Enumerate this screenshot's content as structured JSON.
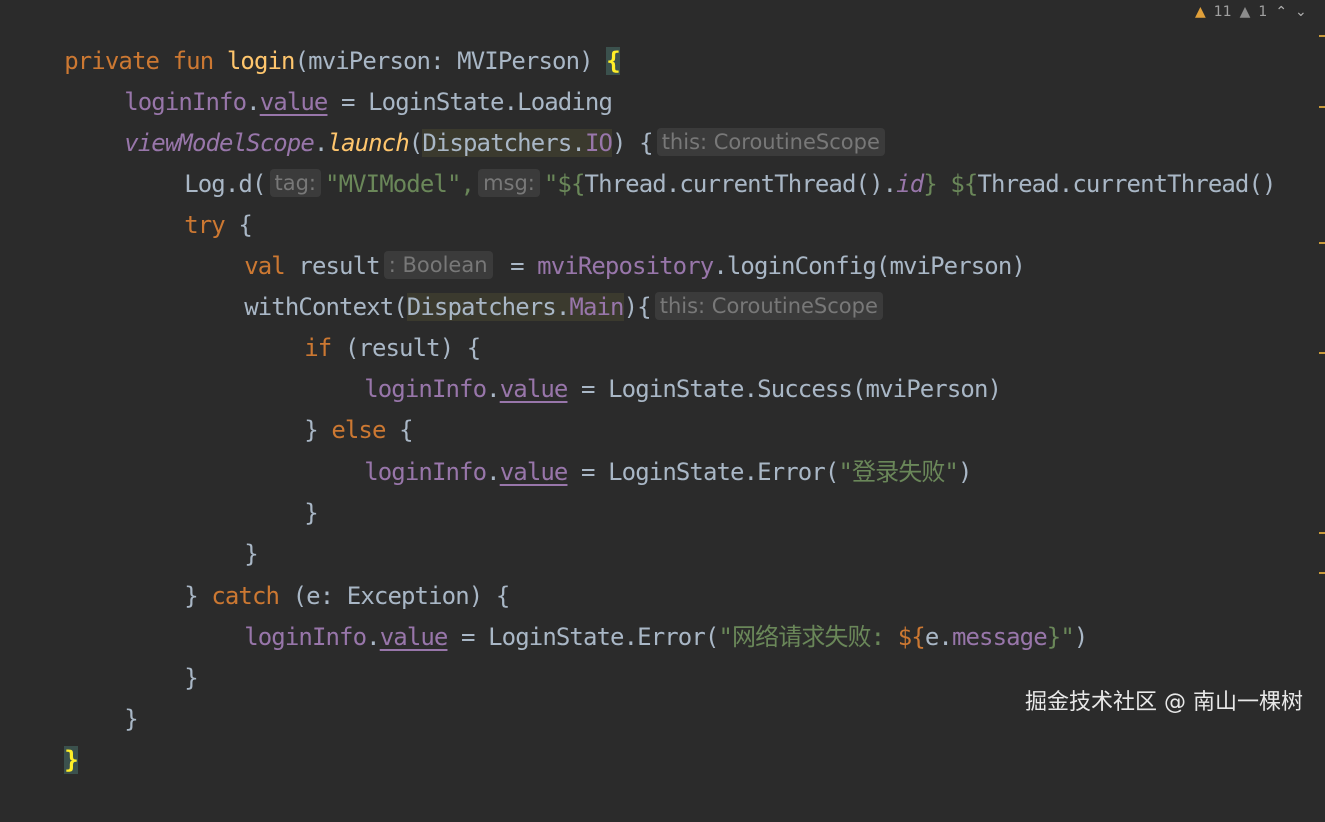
{
  "inspection": {
    "warnings": "11",
    "weak_warnings": "1"
  },
  "watermark": "掘金技术社区 @ 南山一棵树",
  "code": {
    "l1": {
      "kw1": "private",
      "kw2": "fun",
      "name": "login",
      "params": "(mviPerson: MVIPerson) ",
      "brace": "{"
    },
    "l2": {
      "a": "loginInfo",
      "dot": ".",
      "b": "value",
      "rest": " = LoginState.Loading"
    },
    "l3": {
      "a": "viewModelScope",
      "dot": ".",
      "b": "launch",
      "p1": "(",
      "c": "Dispatchers",
      "dot2": ".",
      "d": "IO",
      "p2": ") {",
      "hint": "this: CoroutineScope"
    },
    "l4": {
      "a": "Log.d(",
      "hint1": "tag:",
      "s1": "\"MVIModel\",",
      "hint2": "msg:",
      "s2": "\"${",
      "b": "Thread.currentThread().",
      "c": "id",
      "s3": "} ${",
      "d": "Thread.currentThread()"
    },
    "l5": {
      "kw": "try",
      "rest": " {"
    },
    "l6": {
      "kw": "val",
      "a": " result",
      "hint": ": Boolean",
      "b": " = ",
      "c": "mviRepository",
      "d": ".loginConfig(mviPerson)"
    },
    "l7": {
      "a": "withContext(",
      "c": "Dispatchers",
      "dot": ".",
      "d": "Main",
      "b": "){",
      "hint": "this: CoroutineScope"
    },
    "l8": {
      "kw": "if",
      "rest": " (result) {"
    },
    "l9": {
      "a": "loginInfo",
      "dot": ".",
      "b": "value",
      "rest": " = LoginState.Success(mviPerson)"
    },
    "l10": {
      "a": "} ",
      "kw": "else",
      "rest": " {"
    },
    "l11": {
      "a": "loginInfo",
      "dot": ".",
      "b": "value",
      "rest": " = LoginState.Error(",
      "s": "\"登录失败\"",
      "end": ")"
    },
    "l12": {
      "a": "}"
    },
    "l13": {
      "a": "}"
    },
    "l14": {
      "a": "} ",
      "kw": "catch",
      "rest": " (e: Exception) {"
    },
    "l15": {
      "a": "loginInfo",
      "dot": ".",
      "b": "value",
      "rest": " = LoginState.Error(",
      "s1": "\"网络请求失败: ",
      "s2": "${",
      "c": "e.",
      "d": "message",
      "s3": "}\"",
      "end": ")"
    },
    "l16": {
      "a": "}"
    },
    "l17": {
      "a": "}"
    },
    "l18": {
      "a": "}"
    }
  }
}
